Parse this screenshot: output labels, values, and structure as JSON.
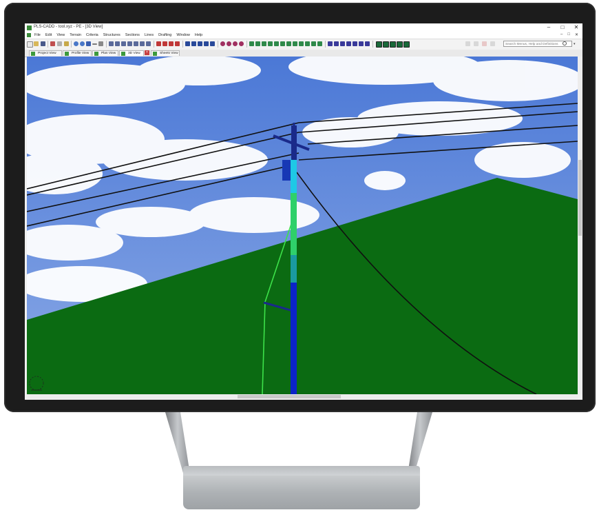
{
  "window": {
    "title": "PLS-CADD - tool.xyz - PE - [3D View]",
    "controls": {
      "minimize": "‒",
      "maximize": "□",
      "close": "✕"
    },
    "mdi_controls": {
      "minimize": "–",
      "restore": "□",
      "close": "✕"
    }
  },
  "menu": {
    "items": [
      "File",
      "Edit",
      "View",
      "Terrain",
      "Criteria",
      "Structures",
      "Sections",
      "Lines",
      "Drafting",
      "Window",
      "Help"
    ]
  },
  "search": {
    "placeholder": "Search Menus, Help and Definitions"
  },
  "tabs": [
    {
      "label": "Project View",
      "active": false
    },
    {
      "label": "Profile View",
      "active": false
    },
    {
      "label": "Plan View",
      "active": false
    },
    {
      "label": "3D View",
      "active": true
    },
    {
      "label": "Sheets View",
      "active": false
    }
  ],
  "tab_close": "×",
  "scene": {
    "description_visible": false,
    "colors": {
      "sky_top": "#4b78d6",
      "sky_bottom": "#8aa9e6",
      "cloud": "#ffffff",
      "ground": "#0b6b12",
      "wire": "#101010",
      "pole_top": "#1ec8e6",
      "pole_mid": "#2fd06a",
      "pole_low": "#1a9aa0",
      "pole_base": "#0b23c8",
      "guy_wire": "#3de24a",
      "crossarm": "#1a2a8a"
    }
  },
  "icons": {
    "app": "pls-cadd-icon",
    "search": "search-icon",
    "axis_gizmo": "axis-gizmo-icon"
  }
}
